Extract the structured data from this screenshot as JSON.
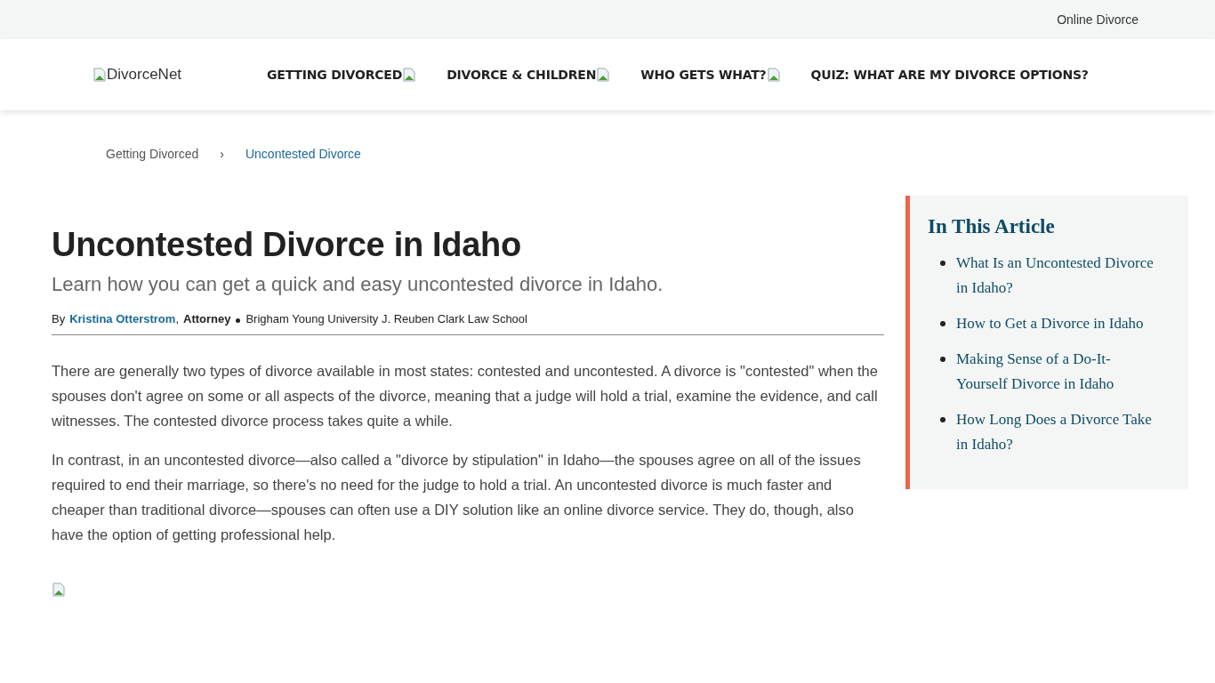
{
  "top_bar": {
    "link": "Online Divorce"
  },
  "header": {
    "logo_alt": "DivorceNet",
    "nav": [
      {
        "label": "GETTING DIVORCED",
        "has_icon": true
      },
      {
        "label": "DIVORCE & CHILDREN",
        "has_icon": true
      },
      {
        "label": "WHO GETS WHAT?",
        "has_icon": true
      },
      {
        "label": "QUIZ: WHAT ARE MY DIVORCE OPTIONS?",
        "has_icon": false
      }
    ]
  },
  "breadcrumb": {
    "items": [
      {
        "label": "Getting Divorced",
        "selected": false
      },
      {
        "label": "Uncontested Divorce",
        "selected": true
      }
    ],
    "separator": "›"
  },
  "article": {
    "title": "Uncontested Divorce in Idaho",
    "subtitle": "Learn how you can get a quick and easy uncontested divorce in Idaho.",
    "byline": {
      "by": "By",
      "author": "Kristina Otterstrom",
      "comma": ",",
      "role": "Attorney",
      "school": "Brigham Young University J. Reuben Clark Law School"
    },
    "paragraphs": [
      "There are generally two types of divorce available in most states: contested and uncontested. A divorce is \"contested\" when the spouses don't agree on some or all aspects of the divorce, meaning that a judge will hold a trial, examine the evidence, and call witnesses. The contested divorce process takes quite a while.",
      "In contrast, in an uncontested divorce—also called a \"divorce by stipulation\" in Idaho—the spouses agree on all of the issues required to end their marriage, so there's no need for the judge to hold a trial. An uncontested divorce is much faster and cheaper than traditional divorce—spouses can often use a DIY solution like an online divorce service. They do, though, also have the option of getting professional help."
    ]
  },
  "sidebar": {
    "title": "In This Article",
    "items": [
      "What Is an Uncontested Divorce in Idaho?",
      "How to Get a Divorce in Idaho",
      "Making Sense of a Do-It-Yourself Divorce in Idaho",
      "How Long Does a Divorce Take in Idaho?"
    ]
  }
}
